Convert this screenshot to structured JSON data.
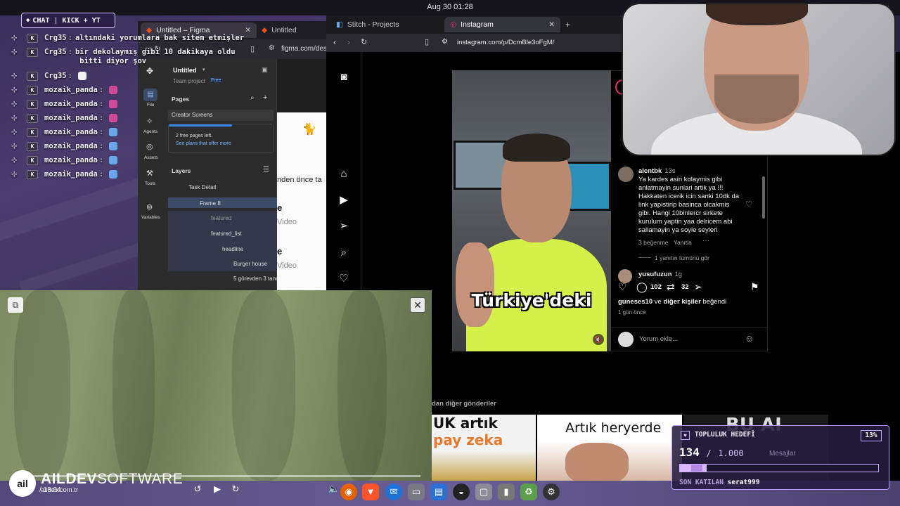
{
  "system": {
    "clock": "Aug 30  01:28"
  },
  "chat": {
    "header_label": "CHAT",
    "header_platforms": "KICK + YT",
    "messages": [
      {
        "user": "Crg35",
        "text": "altındaki yorumlara bak sitem etmişler",
        "emote": ""
      },
      {
        "user": "Crg35",
        "text": "bir dekolaymış gibi 10 dakikaya oldu\n bitti diyor şov",
        "emote": ""
      },
      {
        "user": "Crg35",
        "text": "",
        "emote": "#f0f0f0"
      },
      {
        "user": "mozaik_panda",
        "text": "",
        "emote": "#d04a9a"
      },
      {
        "user": "mozaik_panda",
        "text": "",
        "emote": "#d04a9a"
      },
      {
        "user": "mozaik_panda",
        "text": "",
        "emote": "#d04a9a"
      },
      {
        "user": "mozaik_panda",
        "text": "",
        "emote": "#6aa6e8"
      },
      {
        "user": "mozaik_panda",
        "text": "",
        "emote": "#6aa6e8"
      },
      {
        "user": "mozaik_panda",
        "text": "",
        "emote": "#6aa6e8"
      },
      {
        "user": "mozaik_panda",
        "text": "",
        "emote": "#6aa6e8"
      }
    ]
  },
  "figma": {
    "tab_active": "Untitled – Figma",
    "tab_inactive": "Untitled",
    "url": "figma.com/desi",
    "file_name": "Untitled",
    "team": "Team project",
    "plan": "Free",
    "rail": [
      "File",
      "Agents",
      "Assets",
      "Tools",
      "Variables"
    ],
    "pages_label": "Pages",
    "page_item": "Creator Screens",
    "free_pages_note": "2 free pages left.",
    "plans_link": "See plans that offer more",
    "layers_label": "Layers",
    "layers": [
      "Task Detail",
      "Frame 8",
      "featured",
      "featured_list",
      "headline",
      "Burger house",
      "5 görevden 3 tane"
    ],
    "canvas_texts": [
      "nden önce ta",
      "e",
      "Video",
      "e",
      "Video"
    ]
  },
  "browser": {
    "tab1": "Stitch - Projects",
    "tab2": "Instagram",
    "url": "instagram.com/p/DcmBle3oFgM/"
  },
  "instagram": {
    "reel_caption": "Türkiye'deki",
    "comment1": {
      "user": "alcntbk",
      "time": "13s",
      "text": "Ya kardes asiri kolaymis gibi\nanlatmayin sunlari artik ya !!!\nHakkaten icerik icin sanki 10dk da\nlink yapistirip basinca olcakmis\ngibi. Hangi 10binlercr sirkete\nkurulum yaptin yaa delricem abi\nsallamayin ya soyle seyleri",
      "likes": "3 beğenme",
      "reply": "Yanıtla",
      "view_replies": "1 yanıtın tümünü gör"
    },
    "comment2": {
      "user": "yusufuzun",
      "time": "1g"
    },
    "comment_count": "102",
    "share_count": "32",
    "liked_by_user": "guneses10",
    "liked_by_join": "ve",
    "liked_by_others": "diğer kişiler",
    "liked_by_suffix": "beğendi",
    "posted_ago": "1 gün önce",
    "comment_placeholder": "Yorum ekle...",
    "more_posts_label": "dan diğer gönderiler",
    "thumb1_text1": "UK artık",
    "thumb1_text2": "pay zeka",
    "thumb2_text": "Artık heryerde",
    "thumb3_text": "BU AI"
  },
  "player": {
    "brand_bold": "AILDEV",
    "brand_light": "SOFTWARE",
    "brand_site": "aildev.com.tr",
    "time_fragment": "/ 13:04"
  },
  "goal": {
    "title": "TOPLULUK HEDEFİ",
    "percent": "13%",
    "current": "134",
    "separator": "/",
    "target": "1.000",
    "progress_fraction": 0.134,
    "last_label": "SON KATILAN",
    "last_user": "serat999",
    "messages_label": "Mesajlar"
  }
}
